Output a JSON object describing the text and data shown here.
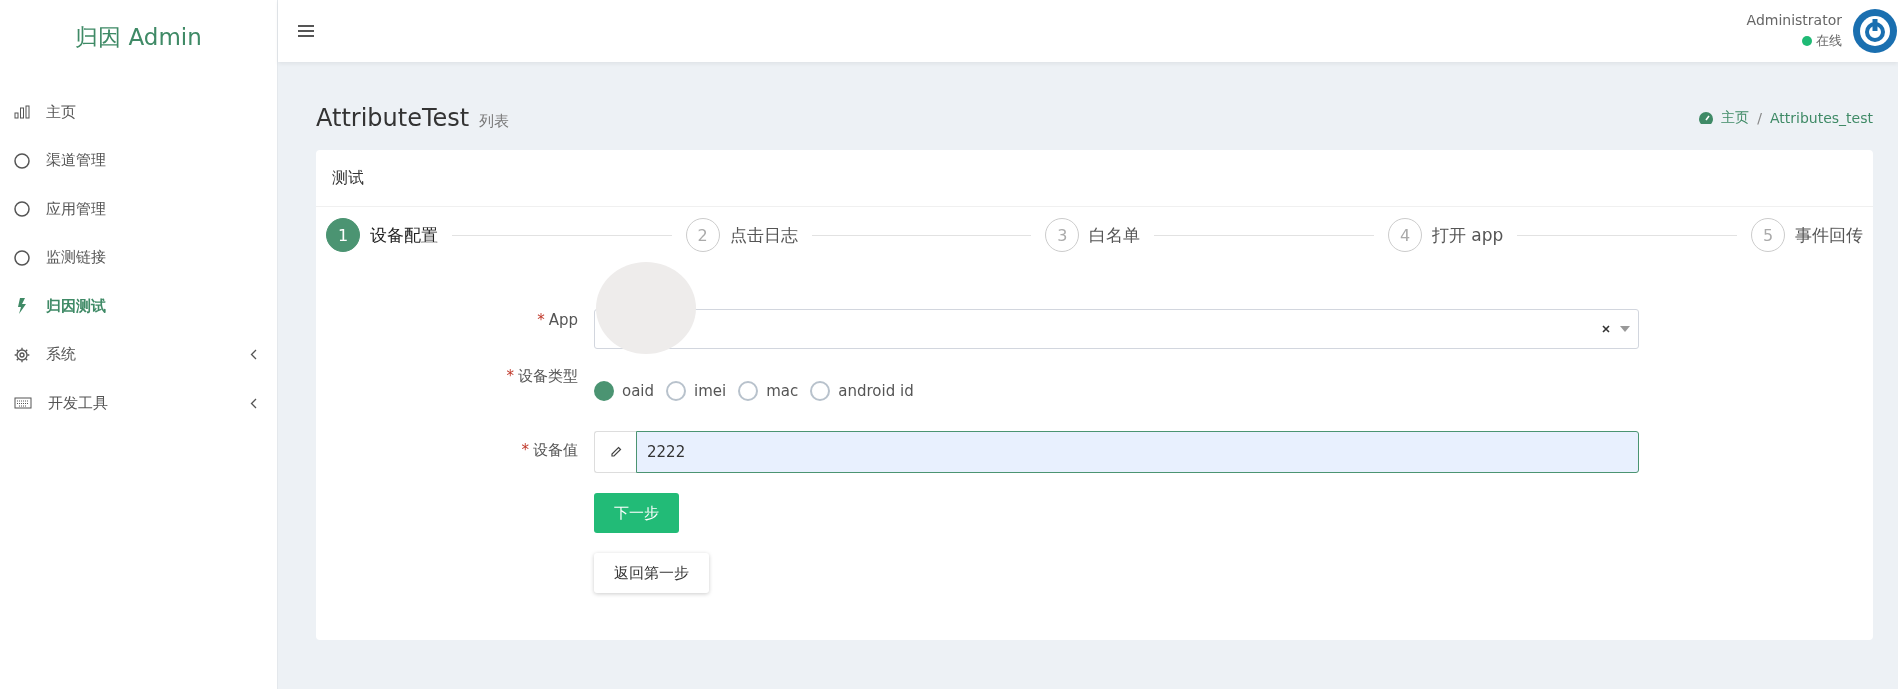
{
  "sidebar": {
    "logo": "归因 Admin",
    "items": [
      {
        "label": "主页",
        "kind": "chart",
        "selected": false,
        "submenu": false
      },
      {
        "label": "渠道管理",
        "kind": "circle",
        "selected": false,
        "submenu": false
      },
      {
        "label": "应用管理",
        "kind": "circle",
        "selected": false,
        "submenu": false
      },
      {
        "label": "监测链接",
        "kind": "circle",
        "selected": false,
        "submenu": false
      },
      {
        "label": "归因测试",
        "kind": "bolt",
        "selected": true,
        "submenu": false
      },
      {
        "label": "系统",
        "kind": "gear",
        "selected": false,
        "submenu": true
      },
      {
        "label": "开发工具",
        "kind": "keyboard",
        "selected": false,
        "submenu": true
      }
    ]
  },
  "header": {
    "user": "Administrator",
    "status": "在线"
  },
  "page": {
    "title": "AttributeTest",
    "subtitle": "列表",
    "breadcrumb": [
      "主页",
      "Attributes_test"
    ],
    "breadcrumb_separator": "/"
  },
  "card": {
    "title": "测试",
    "steps": [
      {
        "number": "1",
        "label": "设备配置",
        "selected": true
      },
      {
        "number": "2",
        "label": "点击日志",
        "selected": false
      },
      {
        "number": "3",
        "label": "白名单",
        "selected": false
      },
      {
        "number": "4",
        "label": "打开 app",
        "selected": false
      },
      {
        "number": "5",
        "label": "事件回传",
        "selected": false
      }
    ],
    "form": {
      "app_mark": "*",
      "app_label": "App",
      "type_mark": "*",
      "type_label": "设备类型",
      "types": [
        {
          "label": "oaid",
          "selected": true
        },
        {
          "label": "imei",
          "selected": false
        },
        {
          "label": "mac",
          "selected": false
        },
        {
          "label": "android id",
          "selected": false
        }
      ],
      "value_mark": "*",
      "value_label": "设备值",
      "value": "2222"
    },
    "buttons": {
      "next": "下一步",
      "back": "返回第一步"
    }
  }
}
